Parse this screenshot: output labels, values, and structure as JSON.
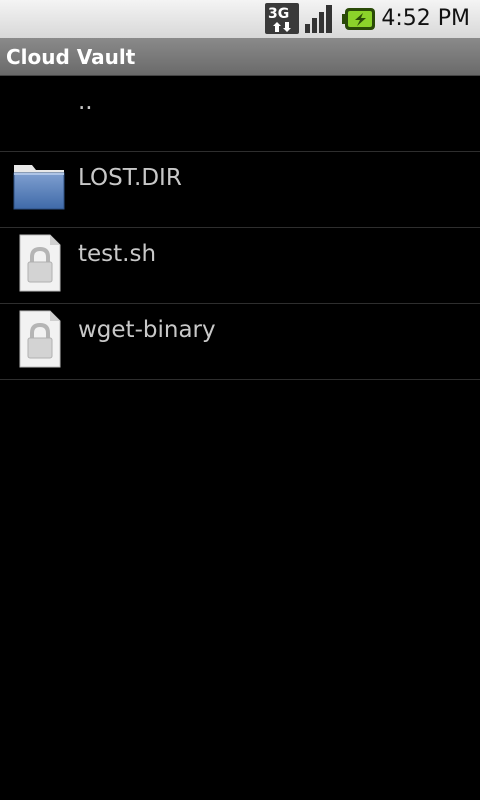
{
  "status_bar": {
    "network_label": "3G",
    "network_icon": "network-3g-icon",
    "signal_icon": "signal-strength-icon",
    "battery_icon": "battery-charging-icon",
    "time": "4:52 PM"
  },
  "app": {
    "title": "Cloud Vault"
  },
  "files": [
    {
      "name": "..",
      "icon": "none"
    },
    {
      "name": "LOST.DIR",
      "icon": "folder-icon"
    },
    {
      "name": "test.sh",
      "icon": "locked-file-icon"
    },
    {
      "name": "wget-binary",
      "icon": "locked-file-icon"
    }
  ]
}
